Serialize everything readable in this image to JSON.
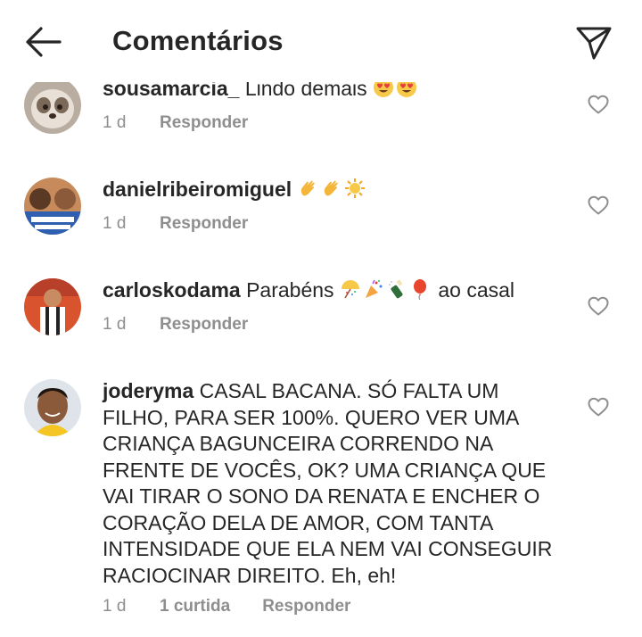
{
  "header": {
    "title": "Comentários",
    "back_icon": "arrow-left-icon",
    "send_icon": "paper-plane-icon"
  },
  "comments": [
    {
      "username": "sousamarcia_",
      "text": " Lindo demais ",
      "emojis": [
        "heart-eyes-emoji",
        "heart-eyes-emoji"
      ],
      "time": "1 d",
      "reply": "Responder"
    },
    {
      "username": "danielribeiromiguel",
      "text": " ",
      "emojis": [
        "clapping-hands-emoji",
        "clapping-hands-emoji",
        "sun-emoji"
      ],
      "time": "1 d",
      "reply": "Responder"
    },
    {
      "username": "carloskodama",
      "text": " Parabéns ",
      "emojis": [
        "confetti-ball-emoji",
        "party-popper-emoji",
        "champagne-emoji",
        "balloon-emoji"
      ],
      "text_after": " ao casal",
      "time": "1 d",
      "reply": "Responder"
    },
    {
      "username": "joderyma",
      "text": " CASAL BACANA. SÓ FALTA UM FILHO, PARA SER 100%. QUERO VER UMA CRIANÇA BAGUNCEIRA CORRENDO NA FRENTE DE VOCÊS, OK? UMA CRIANÇA QUE VAI TIRAR O SONO DA RENATA E ENCHER O CORAÇÃO DELA DE AMOR, COM TANTA INTENSIDADE QUE ELA NEM VAI CONSEGUIR RACIOCINAR DIREITO. Eh, eh!",
      "time": "1 d",
      "likes": "1 curtida",
      "reply": "Responder"
    }
  ],
  "colors": {
    "text": "#262626",
    "secondary": "#8e8e8e",
    "background": "#ffffff"
  }
}
